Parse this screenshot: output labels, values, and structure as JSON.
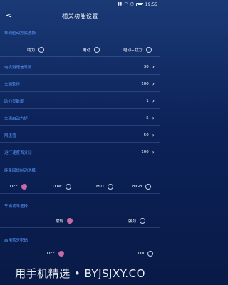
{
  "status_bar": {
    "time": "19:55"
  },
  "app_bar": {
    "title": "相关功能设置"
  },
  "drive_mode": {
    "section_label": "车辆驱动方式选择",
    "options": [
      {
        "label": "助力",
        "checked": false
      },
      {
        "label": "电动",
        "checked": false
      },
      {
        "label": "电动+助力",
        "checked": false
      }
    ]
  },
  "settings": [
    {
      "label": "电机测速信号数",
      "value": "30"
    },
    {
      "label": "车辆轮径",
      "value": "100"
    },
    {
      "label": "助力灵敏度",
      "value": "1"
    },
    {
      "label": "车辆启动力矩",
      "value": "5"
    },
    {
      "label": "限速值",
      "value": "50"
    },
    {
      "label": "运行速度百分比",
      "value": "100"
    }
  ],
  "regen_brake": {
    "section_label": "能量回馈制动选择",
    "options": [
      {
        "label": "OFF",
        "checked": true
      },
      {
        "label": "LOW",
        "checked": false
      },
      {
        "label": "MID",
        "checked": false
      },
      {
        "label": "HIGH",
        "checked": false
      }
    ]
  },
  "power_mode": {
    "section_label": "车辆功率选择",
    "options": [
      {
        "label": "常规",
        "checked": true
      },
      {
        "label": "强劲",
        "checked": false
      }
    ]
  },
  "bluetooth_pwd": {
    "section_label": "启用蓝牙密码",
    "options": [
      {
        "label": "OFF",
        "checked": true
      },
      {
        "label": "ON",
        "checked": false
      }
    ]
  },
  "watermark": "用手机精选 • BYJSJXY.CO"
}
